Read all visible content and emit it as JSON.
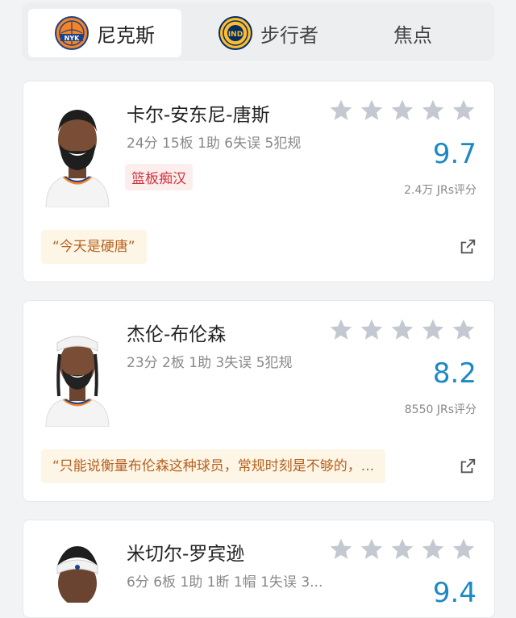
{
  "tabs": [
    {
      "label": "尼克斯",
      "logo": "NYK",
      "active": true
    },
    {
      "label": "步行者",
      "logo": "IND",
      "active": false
    },
    {
      "label": "焦点",
      "active": false
    }
  ],
  "players": [
    {
      "name": "卡尔-安东尼-唐斯",
      "stats": "24分 15板 1助 6失误 5犯规",
      "badge": "篮板痴汉",
      "rating": "9.7",
      "votes": "2.4万 JRs评分",
      "quote": "“今天是硬唐”"
    },
    {
      "name": "杰伦-布伦森",
      "stats": "23分 2板 1助 3失误 5犯规",
      "rating": "8.2",
      "votes": "8550 JRs评分",
      "quote": "“只能说衡量布伦森这种球员，常规时刻是不够的，..."
    },
    {
      "name": "米切尔-罗宾逊",
      "stats": "6分 6板 1助 1断 1帽 1失误 3...",
      "rating": "9.4"
    }
  ],
  "colors": {
    "rating": "#1c89c4",
    "badge": "#d0323c",
    "quote_text": "#b8611f",
    "quote_bg": "#fdf6e6",
    "star": "#c4c9d1"
  }
}
